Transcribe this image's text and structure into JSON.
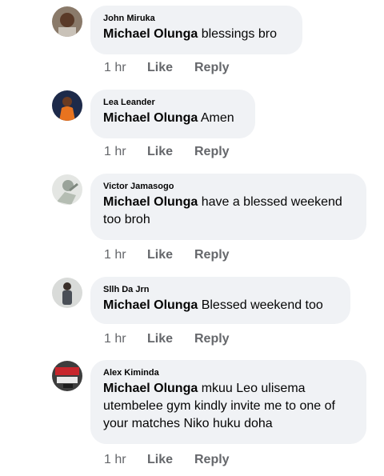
{
  "comments": [
    {
      "author": "John Miruka",
      "mention": "Michael Olunga",
      "text": " blessings bro",
      "time": "1 hr",
      "like": "Like",
      "reply": "Reply"
    },
    {
      "author": "Lea Leander",
      "mention": "Michael Olunga",
      "text": " Amen",
      "time": "1 hr",
      "like": "Like",
      "reply": "Reply"
    },
    {
      "author": "Victor Jamasogo",
      "mention": "Michael Olunga",
      "text": " have a blessed weekend too broh",
      "time": "1 hr",
      "like": "Like",
      "reply": "Reply"
    },
    {
      "author": "Sllh Da Jrn",
      "mention": "Michael Olunga",
      "text": " Blessed weekend too",
      "time": "1 hr",
      "like": "Like",
      "reply": "Reply"
    },
    {
      "author": "Alex Kiminda",
      "mention": "Michael Olunga",
      "text": " mkuu Leo ulisema utembelee gym kindly invite me to one of your matches Niko huku doha",
      "time": "1 hr",
      "like": "Like",
      "reply": "Reply"
    }
  ],
  "colors": {
    "bubble": "#f0f2f5",
    "meta": "#65676b",
    "text": "#050505"
  }
}
